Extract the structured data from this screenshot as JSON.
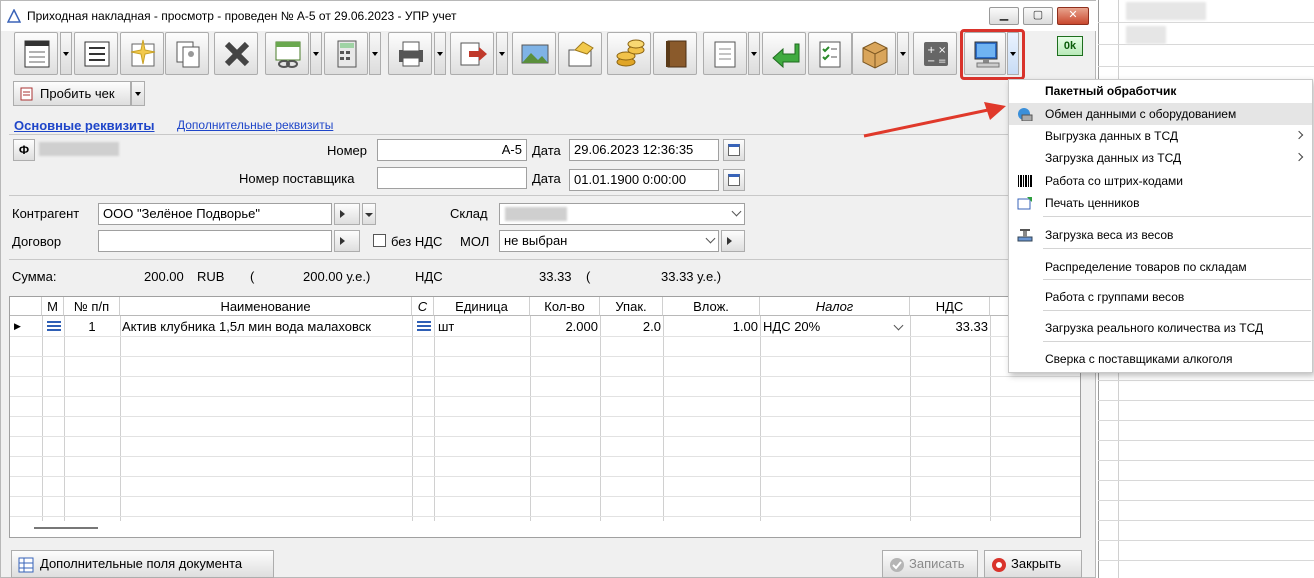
{
  "window": {
    "title": "Приходная накладная - просмотр - проведен № А-5 от 29.06.2023 - УПР учет",
    "ok_label": "0k"
  },
  "toolbar": {
    "check_button": "Пробить чек"
  },
  "tabs": {
    "main": "Основные реквизиты",
    "extra": "Дополнительные реквизиты"
  },
  "header": {
    "phi_button": "Ф",
    "number_label": "Номер",
    "number_value": "А-5",
    "date_label": "Дата",
    "date_value": "29.06.2023 12:36:35",
    "supplier_number_label": "Номер поставщика",
    "supplier_number_value": "",
    "date2_label": "Дата",
    "date2_value": "01.01.1900 0:00:00"
  },
  "fields": {
    "counterparty_label": "Контрагент",
    "counterparty_value": "ООО \"Зелёное Подворье\"",
    "warehouse_label": "Склад",
    "contract_label": "Договор",
    "contract_value": "",
    "no_vat_label": "без НДС",
    "mol_label": "МОЛ",
    "mol_value": "не выбран"
  },
  "totals": {
    "sum_label": "Сумма:",
    "sum_value": "200.00",
    "currency": "RUB",
    "open_paren": "(",
    "sum_ue": "200.00 у.е.)",
    "vat_label": "НДС",
    "vat_value": "33.33",
    "vat_open_paren": "(",
    "vat_ue": "33.33 у.е.)"
  },
  "grid": {
    "columns": [
      "М",
      "№ п/п",
      "Наименование",
      "С",
      "Единица",
      "Кол-во",
      "Упак.",
      "Влож.",
      "Налог",
      "НДС"
    ],
    "rows": [
      {
        "num": "1",
        "name": "Актив  клубника 1,5л мин вода малаховск",
        "unit": "шт",
        "qty": "2.000",
        "pack": "2.0",
        "inner": "1.00",
        "tax": "НДС 20%",
        "vat": "33.33"
      }
    ]
  },
  "bottom": {
    "extra_fields": "Дополнительные поля документа",
    "save": "Записать",
    "close": "Закрыть"
  },
  "menu": {
    "header": "Пакетный обработчик",
    "items": [
      {
        "label": "Обмен данными с оборудованием",
        "icon": "equipment-exchange-icon"
      },
      {
        "label": "Выгрузка данных в ТСД",
        "icon": "submenu-arrow"
      },
      {
        "label": "Загрузка данных из ТСД",
        "icon": "submenu-arrow"
      },
      {
        "label": "Работа со штрих-кодами",
        "icon": "barcode-icon"
      },
      {
        "label": "Печать ценников",
        "icon": "price-tag-print-icon"
      },
      {
        "label": "Загрузка веса из весов",
        "icon": "scale-icon"
      },
      {
        "label": "Распределение товаров по складам",
        "icon": ""
      },
      {
        "label": "Работа с группами весов",
        "icon": ""
      },
      {
        "label": "Загрузка реального количества из ТСД",
        "icon": ""
      },
      {
        "label": "Сверка с поставщиками алкоголя",
        "icon": ""
      }
    ]
  },
  "colors": {
    "accent_link": "#1f46c9",
    "highlight_red": "#d9332b",
    "menu_hover": "#e5e5e5"
  }
}
